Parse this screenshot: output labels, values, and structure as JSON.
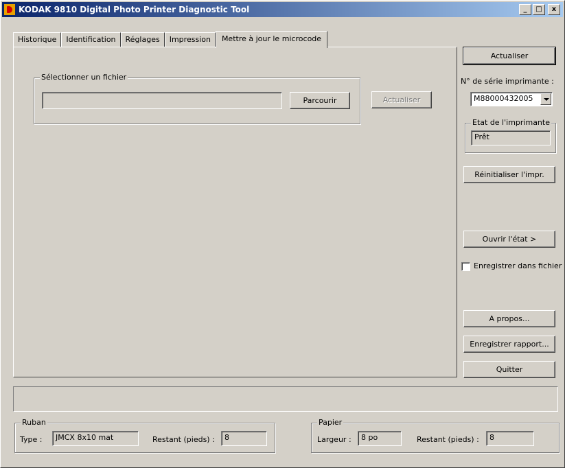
{
  "window": {
    "title": "KODAK 9810 Digital Photo Printer Diagnostic Tool",
    "minimize": "_",
    "maximize": "□",
    "close": "x"
  },
  "tabs": [
    {
      "label": "Historique"
    },
    {
      "label": "Identification"
    },
    {
      "label": "Réglages"
    },
    {
      "label": "Impression"
    },
    {
      "label": "Mettre à jour le microcode"
    }
  ],
  "firmware": {
    "group_label": "Sélectionner un fichier",
    "file_value": "",
    "browse_label": "Parcourir",
    "update_label": "Actualiser"
  },
  "side": {
    "refresh_label": "Actualiser",
    "serial_label": "N° de série imprimante :",
    "serial_value": "M88000432005",
    "state_group": "Etat de l'imprimante",
    "state_value": "Prêt",
    "reset_label": "Réinitialiser l'impr.",
    "open_state_label": "Ouvrir l'état >",
    "save_to_file_label": "Enregistrer dans fichier",
    "about_label": "A propos...",
    "save_report_label": "Enregistrer rapport...",
    "quit_label": "Quitter"
  },
  "status_text": "",
  "ribbon": {
    "group_label": "Ruban",
    "type_label": "Type :",
    "type_value": "JMCX 8x10 mat",
    "remaining_label": "Restant (pieds) :",
    "remaining_value": "8"
  },
  "paper": {
    "group_label": "Papier",
    "width_label": "Largeur :",
    "width_value": "8 po",
    "remaining_label": "Restant (pieds) :",
    "remaining_value": "8"
  }
}
